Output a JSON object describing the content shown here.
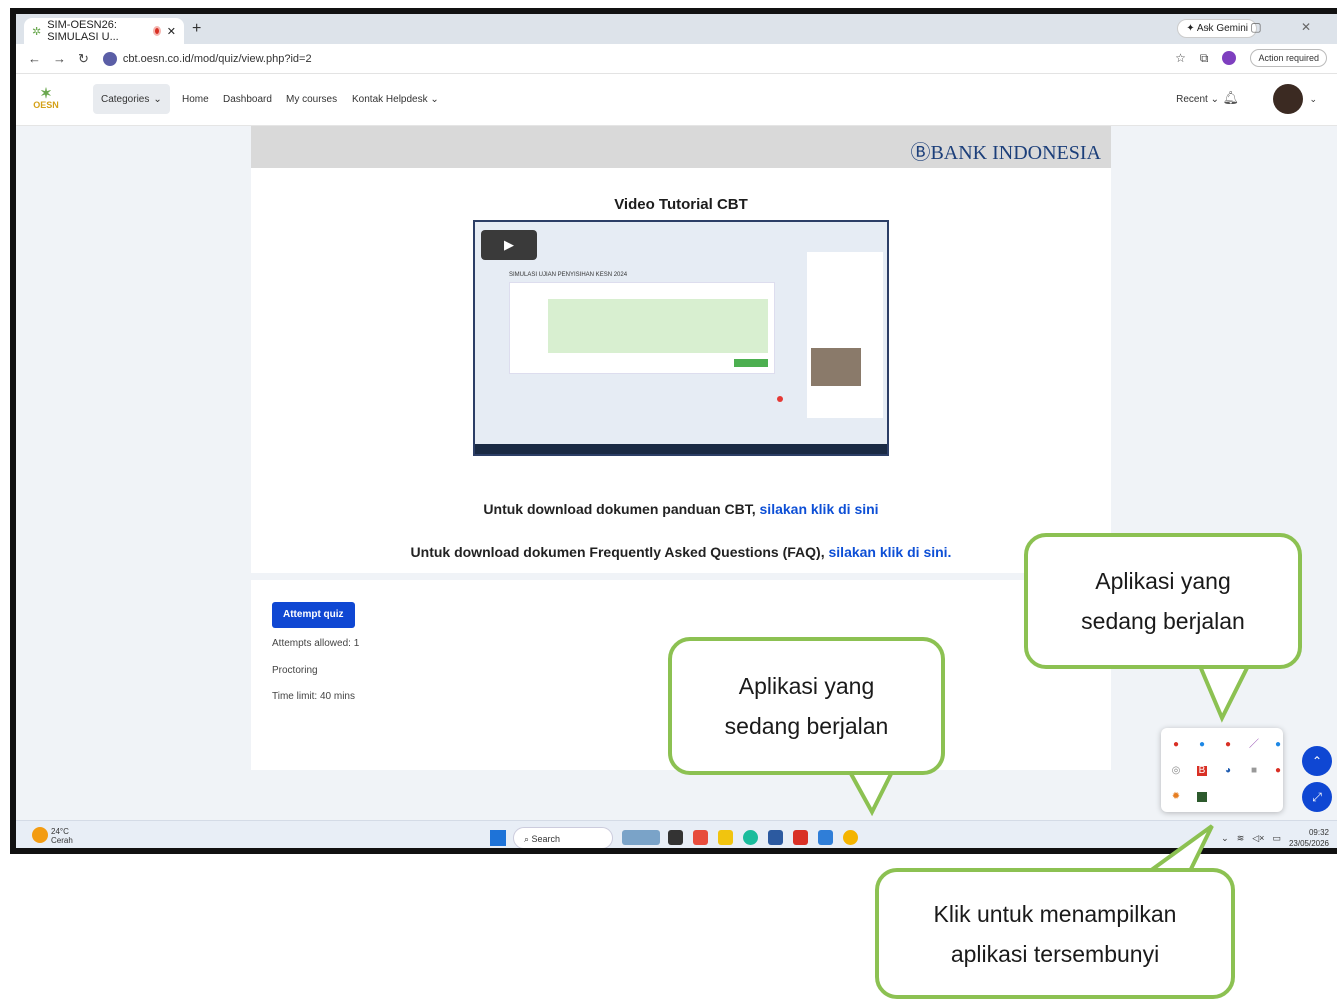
{
  "browser": {
    "tab_title": "SIM-OESN26: SIMULASI U...",
    "new_tab": "+",
    "ask_gemini": "Ask Gemini",
    "url": "cbt.oesn.co.id/mod/quiz/view.php?id=2",
    "action_required": "Action required"
  },
  "nav": {
    "logo_text": "OESN",
    "categories": "Categories",
    "home": "Home",
    "dashboard": "Dashboard",
    "my_courses": "My courses",
    "helpdesk": "Kontak Helpdesk",
    "recent": "Recent"
  },
  "banner": {
    "logo_text": "BANK INDONESIA"
  },
  "video": {
    "title": "Video Tutorial CBT",
    "inner_title": "SIMULASI UJIAN PENYISIHAN KESN 2024"
  },
  "downloads": {
    "line1_text": "Untuk download dokumen panduan CBT,",
    "line1_link": "silakan klik di sini",
    "line2_text": "Untuk download dokumen Frequently Asked Questions (FAQ),",
    "line2_link": "silakan klik di sini."
  },
  "quiz": {
    "attempt_button": "Attempt quiz",
    "attempts_allowed": "Attempts allowed: 1",
    "proctoring": "Proctoring",
    "time_limit": "Time limit: 40 mins"
  },
  "taskbar": {
    "temperature": "24°C",
    "weather": "Cerah",
    "search": "Search",
    "time": "09:32",
    "date": "23/05/2026"
  },
  "callouts": {
    "running_line1": "Aplikasi yang",
    "running_line2": "sedang berjalan",
    "hidden_line1": "Klik untuk menampilkan",
    "hidden_line2": "aplikasi tersembunyi"
  },
  "colors": {
    "accent": "#0f47d3",
    "callout_border": "#8cc152",
    "link": "#0d4fd6"
  }
}
